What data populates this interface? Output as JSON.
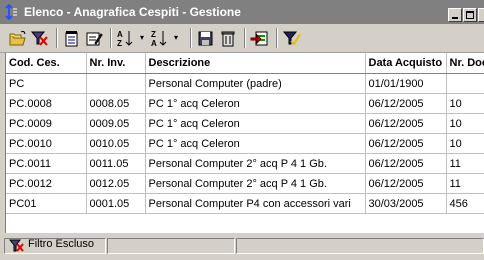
{
  "window": {
    "title": "Elenco - Anagrafica Cespiti - Gestione"
  },
  "toolbar": {
    "buttons": [
      {
        "name": "open-folder-icon"
      },
      {
        "name": "clear-filter-icon"
      },
      {
        "name": "delete-record-icon"
      },
      {
        "name": "edit-record-icon"
      },
      {
        "name": "sort-az-icon"
      },
      {
        "name": "sort-za-icon"
      },
      {
        "name": "save-icon"
      },
      {
        "name": "trash-icon"
      },
      {
        "name": "export-icon"
      },
      {
        "name": "filter-icon"
      }
    ]
  },
  "grid": {
    "columns": [
      "Cod. Ces.",
      "Nr. Inv.",
      "Descrizione",
      "Data Acquisto",
      "Nr. Doc"
    ],
    "rows": [
      [
        "PC",
        "",
        "Personal Computer (padre)",
        "01/01/1900",
        ""
      ],
      [
        "PC.0008",
        "0008.05",
        "PC  1° acq  Celeron",
        "06/12/2005",
        "10"
      ],
      [
        "PC.0009",
        "0009.05",
        "PC  1° acq  Celeron",
        "06/12/2005",
        "10"
      ],
      [
        "PC.0010",
        "0010.05",
        "PC  1° acq  Celeron",
        "06/12/2005",
        "10"
      ],
      [
        "PC.0011",
        "0011.05",
        "Personal Computer 2° acq  P 4 1 Gb.",
        "06/12/2005",
        "11"
      ],
      [
        "PC.0012",
        "0012.05",
        "Personal Computer 2° acq  P 4 1 Gb.",
        "06/12/2005",
        "11"
      ],
      [
        "PC01",
        "0001.05",
        "Personal Computer P4 con accessori vari",
        "30/03/2005",
        "456"
      ]
    ]
  },
  "status": {
    "filter_text": "Filtro Escluso"
  }
}
